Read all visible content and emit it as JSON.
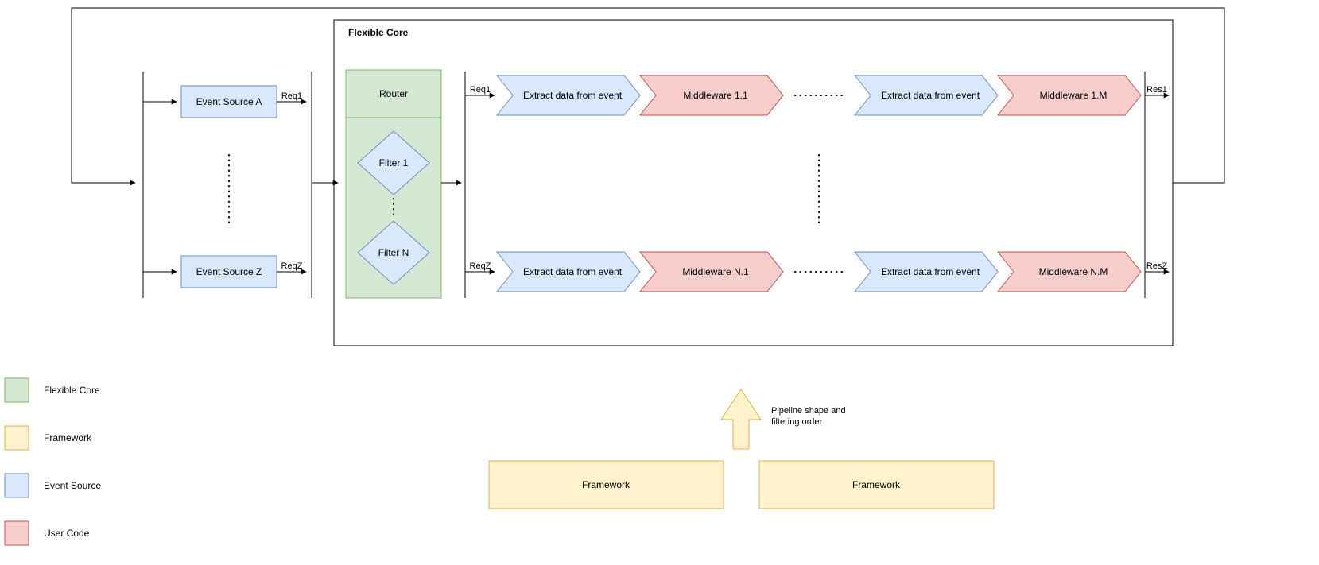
{
  "core": {
    "title": "Flexible Core",
    "router": "Router",
    "filter1": "Filter 1",
    "filterN": "Filter N"
  },
  "sources": {
    "a": "Event Source A",
    "z": "Event Source Z"
  },
  "labels": {
    "req1": "Req1",
    "reqZ": "ReqZ",
    "res1": "Res1",
    "resZ": "ResZ"
  },
  "extract": "Extract data from event",
  "middleware": {
    "m11": "Middleware 1.1",
    "m1M": "Middleware 1.M",
    "mN1": "Middleware N.1",
    "mNM": "Middleware N.M"
  },
  "annotation": "Pipeline shape and\nfiltering order",
  "framework": "Framework",
  "legend": {
    "flexibleCore": "Flexible Core",
    "framework": "Framework",
    "eventSource": "Event Source",
    "userCode": "User Code"
  },
  "colors": {
    "green_fill": "#d5e8d4",
    "green_stroke": "#82b366",
    "yellow_fill": "#fff2cc",
    "yellow_stroke": "#d6b656",
    "blue_fill": "#dae8fc",
    "blue_stroke": "#6c8ebf",
    "red_fill": "#f8cecc",
    "red_stroke": "#b85450",
    "line": "#000"
  }
}
